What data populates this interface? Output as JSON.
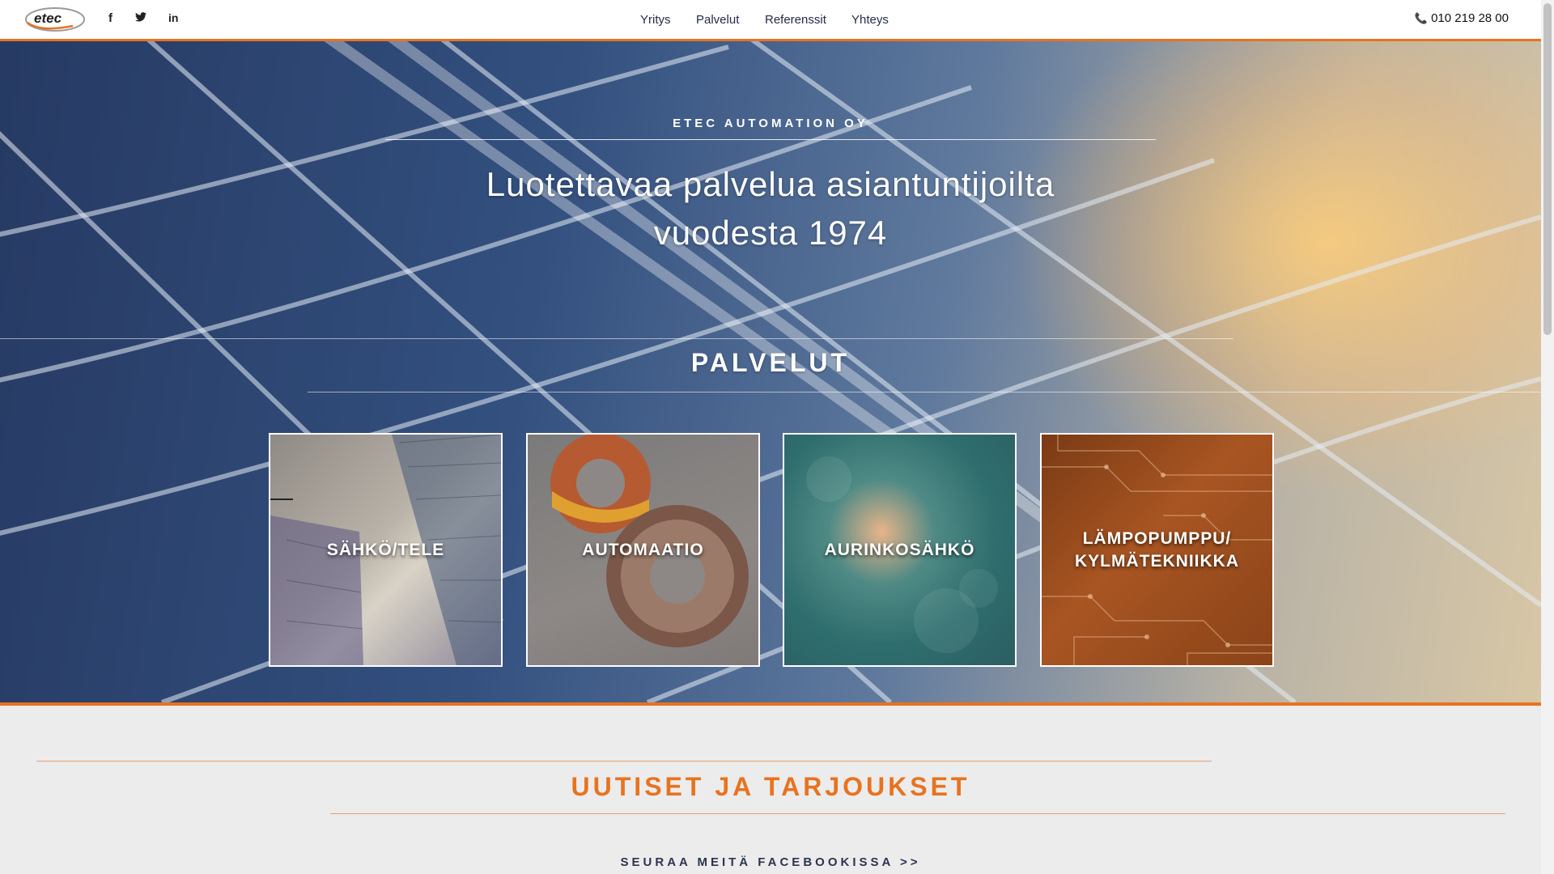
{
  "header": {
    "logo_text": "etec",
    "social": [
      {
        "icon": "facebook-icon",
        "glyph": "f"
      },
      {
        "icon": "twitter-icon",
        "glyph": "🐦"
      },
      {
        "icon": "linkedin-icon",
        "glyph": "in"
      }
    ],
    "nav": [
      "Yritys",
      "Palvelut",
      "Referenssit",
      "Yhteys"
    ],
    "phone": "010 219 28 00",
    "accent_color": "#e8731f"
  },
  "hero": {
    "tagline": "ETEC AUTOMATION OY",
    "title_line1": "Luotettavaa palvelua asiantuntijoilta",
    "title_line2": "vuodesta 1974"
  },
  "services": {
    "title": "PALVELUT",
    "cards": [
      {
        "label": "SÄHKÖ/TELE"
      },
      {
        "label": "AUTOMAATIO"
      },
      {
        "label": "AURINKOSÄHKÖ"
      },
      {
        "label_line1": "LÄMPOPUMPPU/",
        "label_line2": "KYLMÄTEKNIIKKA"
      }
    ]
  },
  "news": {
    "title": "UUTISET JA TARJOUKSET",
    "facebook_link": "SEURAA MEITÄ FACEBOOKISSA >>"
  }
}
